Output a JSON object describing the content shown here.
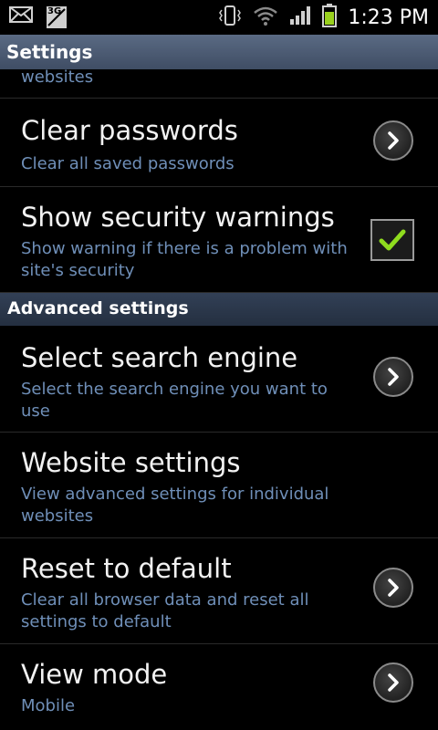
{
  "status": {
    "time": "1:23 PM",
    "network_badge": "3G"
  },
  "title_bar": {
    "title": "Settings"
  },
  "partial_text": "websites",
  "rows_top": [
    {
      "title": "Clear passwords",
      "subtitle": "Clear all saved passwords",
      "control": "chevron"
    },
    {
      "title": "Show security warnings",
      "subtitle": "Show warning if there is a problem with site's security",
      "control": "checkbox",
      "checked": true
    }
  ],
  "section_advanced": {
    "label": "Advanced settings"
  },
  "rows_advanced": [
    {
      "title": "Select search engine",
      "subtitle": "Select the search engine you want to use",
      "control": "chevron"
    },
    {
      "title": "Website settings",
      "subtitle": "View advanced settings for individual websites",
      "control": "none"
    },
    {
      "title": "Reset to default",
      "subtitle": "Clear all browser data and reset all settings to default",
      "control": "chevron"
    },
    {
      "title": "View mode",
      "subtitle": "Mobile",
      "control": "chevron"
    }
  ],
  "colors": {
    "accent_blue": "#6f8fb8",
    "check_green": "#8fdc1e",
    "battery_green": "#9ad11e"
  }
}
